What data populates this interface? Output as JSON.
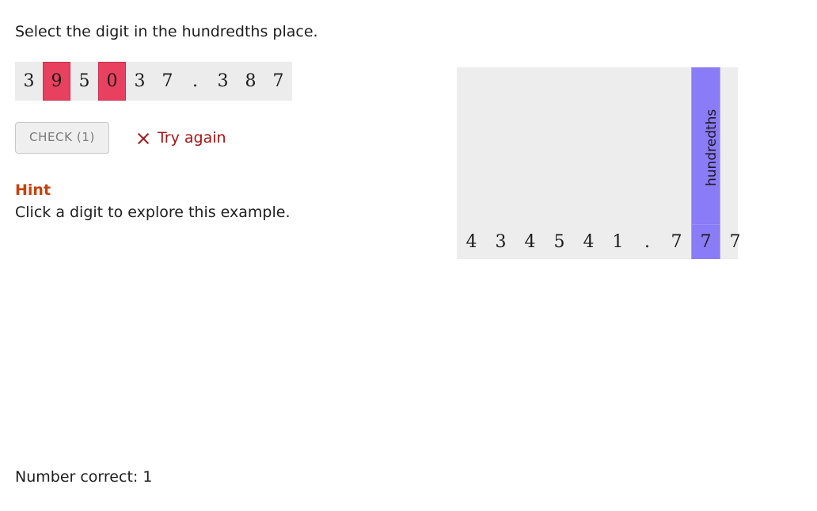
{
  "question": {
    "prompt": "Select the digit in the hundredths place."
  },
  "number_strip": {
    "cells": [
      {
        "char": "3",
        "selected": false
      },
      {
        "char": "9",
        "selected": true
      },
      {
        "char": "5",
        "selected": false
      },
      {
        "char": "0",
        "selected": true
      },
      {
        "char": "3",
        "selected": false
      },
      {
        "char": "7",
        "selected": false
      },
      {
        "char": ".",
        "selected": false
      },
      {
        "char": "3",
        "selected": false
      },
      {
        "char": "8",
        "selected": false
      },
      {
        "char": "7",
        "selected": false
      }
    ],
    "selected_color": "#e8415f",
    "background": "#ececec"
  },
  "controls": {
    "check_label": "CHECK (1)",
    "feedback_text": "Try again",
    "feedback_icon": "x-mark-icon",
    "feedback_color": "#a51414"
  },
  "hint": {
    "title": "Hint",
    "title_color": "#c8400c",
    "text": "Click a digit to explore this example."
  },
  "place_value_panel": {
    "background": "#ededed",
    "highlight_color": "#8a7bf6",
    "columns": [
      {
        "digit": "4",
        "label": "",
        "highlighted": false
      },
      {
        "digit": "3",
        "label": "",
        "highlighted": false
      },
      {
        "digit": "4",
        "label": "",
        "highlighted": false
      },
      {
        "digit": "5",
        "label": "",
        "highlighted": false
      },
      {
        "digit": "4",
        "label": "",
        "highlighted": false
      },
      {
        "digit": "1",
        "label": "",
        "highlighted": false
      },
      {
        "digit": ".",
        "label": "",
        "highlighted": false
      },
      {
        "digit": "7",
        "label": "",
        "highlighted": false
      },
      {
        "digit": "7",
        "label": "hundredths",
        "highlighted": true
      },
      {
        "digit": "7",
        "label": "",
        "highlighted": false
      }
    ]
  },
  "score": {
    "text": "Number correct: 1"
  }
}
